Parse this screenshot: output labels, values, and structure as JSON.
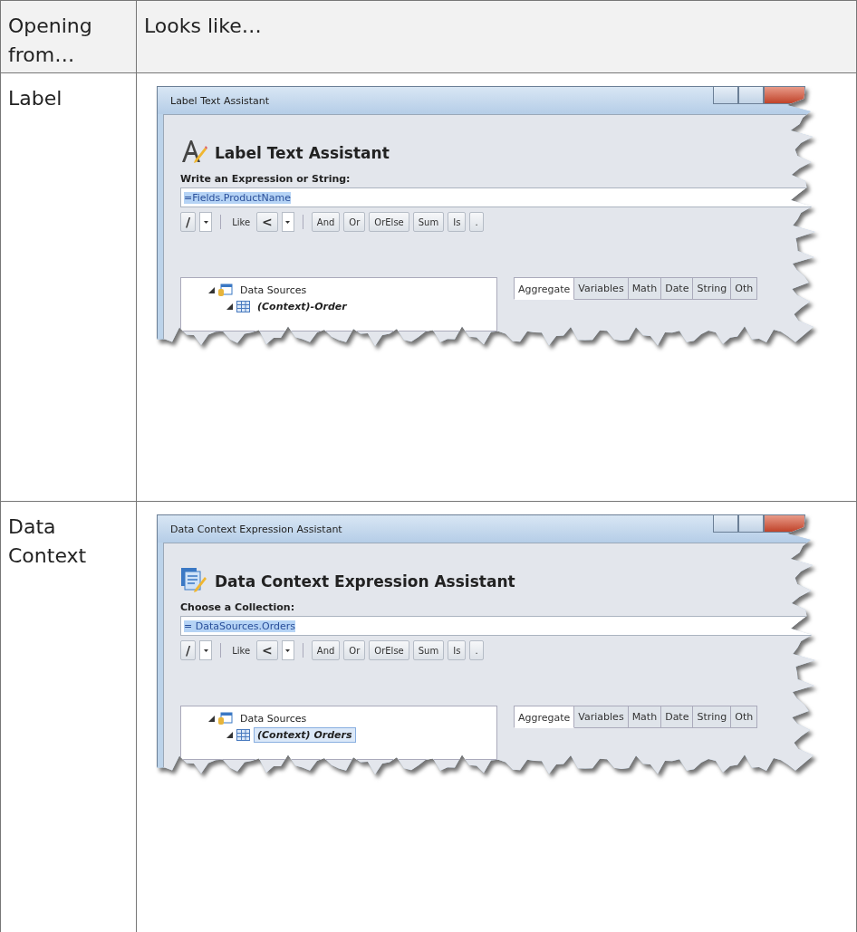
{
  "table": {
    "columns": [
      "Opening from…",
      "Looks like…"
    ],
    "rows": [
      {
        "opening_from": "Label",
        "window": {
          "title": "Label Text Assistant",
          "kind": "label",
          "heading": "Label Text Assistant",
          "prompt": "Write an Expression or String:",
          "expression": "=Fields.ProductName",
          "toolbar": [
            {
              "kind": "button",
              "label": "/"
            },
            {
              "kind": "dropdown"
            },
            {
              "kind": "separator"
            },
            {
              "kind": "label",
              "label": "Like"
            },
            {
              "kind": "button",
              "label": "<"
            },
            {
              "kind": "dropdown"
            },
            {
              "kind": "separator"
            },
            {
              "kind": "button",
              "label": "And"
            },
            {
              "kind": "button",
              "label": "Or"
            },
            {
              "kind": "button",
              "label": "OrElse"
            },
            {
              "kind": "button",
              "label": "Sum"
            },
            {
              "kind": "button",
              "label": "Is"
            },
            {
              "kind": "button",
              "label": "."
            }
          ],
          "tree": [
            {
              "label": "Data Sources",
              "kind": "source",
              "selected": false,
              "children": [
                {
                  "label": "(Context)-Order",
                  "kind": "table",
                  "selected": false
                }
              ]
            }
          ],
          "tabs": [
            {
              "label": "Aggregate",
              "selected": true
            },
            {
              "label": "Variables",
              "selected": false
            },
            {
              "label": "Math",
              "selected": false
            },
            {
              "label": "Date",
              "selected": false
            },
            {
              "label": "String",
              "selected": false
            },
            {
              "label": "Oth",
              "selected": false
            }
          ]
        }
      },
      {
        "opening_from": "Data Context",
        "window": {
          "title": "Data Context Expression Assistant",
          "kind": "data-context",
          "heading": "Data Context Expression Assistant",
          "prompt": "Choose a Collection:",
          "expression": "= DataSources.Orders",
          "toolbar": [
            {
              "kind": "button",
              "label": "/"
            },
            {
              "kind": "dropdown"
            },
            {
              "kind": "separator"
            },
            {
              "kind": "label",
              "label": "Like"
            },
            {
              "kind": "button",
              "label": "<"
            },
            {
              "kind": "dropdown"
            },
            {
              "kind": "separator"
            },
            {
              "kind": "button",
              "label": "And"
            },
            {
              "kind": "button",
              "label": "Or"
            },
            {
              "kind": "button",
              "label": "OrElse"
            },
            {
              "kind": "button",
              "label": "Sum"
            },
            {
              "kind": "button",
              "label": "Is"
            },
            {
              "kind": "button",
              "label": "."
            }
          ],
          "tree": [
            {
              "label": "Data Sources",
              "kind": "source",
              "selected": false,
              "children": [
                {
                  "label": "(Context) Orders",
                  "kind": "table",
                  "selected": true
                }
              ]
            }
          ],
          "tabs": [
            {
              "label": "Aggregate",
              "selected": true
            },
            {
              "label": "Variables",
              "selected": false
            },
            {
              "label": "Math",
              "selected": false
            },
            {
              "label": "Date",
              "selected": false
            },
            {
              "label": "String",
              "selected": false
            },
            {
              "label": "Oth",
              "selected": false
            }
          ]
        }
      }
    ]
  }
}
